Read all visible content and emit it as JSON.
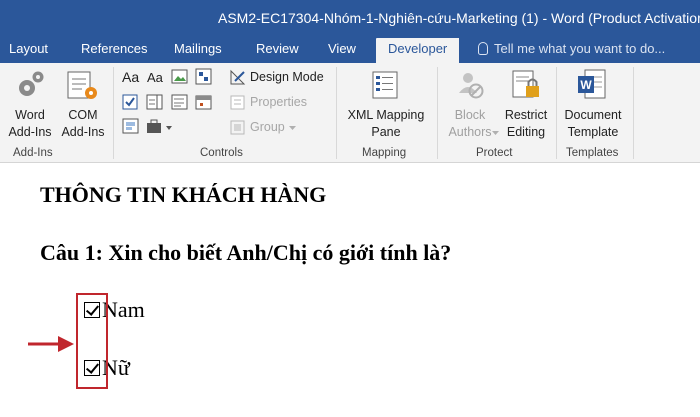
{
  "window": {
    "title": "ASM2-EC17304-Nhóm-1-Nghiên-cứu-Marketing (1) - Word (Product Activation Fa"
  },
  "tabs": {
    "layout": "Layout",
    "references": "References",
    "mailings": "Mailings",
    "review": "Review",
    "view": "View",
    "developer": "Developer",
    "tell_me": "Tell me what you want to do..."
  },
  "ribbon": {
    "addins": {
      "word_addins_line1": "Word",
      "word_addins_line2": "Add-Ins",
      "com_addins_line1": "COM",
      "com_addins_line2": "Add-Ins",
      "group": "Add-Ins"
    },
    "controls": {
      "design_mode": "Design Mode",
      "properties": "Properties",
      "group_btn": "Group",
      "group": "Controls",
      "aa_large": "Aa",
      "aa_small": "Aa"
    },
    "mapping": {
      "xml_line1": "XML Mapping",
      "xml_line2": "Pane",
      "group": "Mapping"
    },
    "protect": {
      "block_line1": "Block",
      "block_line2": "Authors",
      "restrict_line1": "Restrict",
      "restrict_line2": "Editing",
      "group": "Protect"
    },
    "templates": {
      "doc_line1": "Document",
      "doc_line2": "Template",
      "group": "Templates"
    }
  },
  "document": {
    "heading": "THÔNG TIN KHÁCH HÀNG",
    "question": "Câu 1: Xin cho biết Anh/Chị có giới tính là?",
    "options": [
      {
        "label": "Nam",
        "checked": true
      },
      {
        "label": "Nữ",
        "checked": true
      }
    ]
  },
  "colors": {
    "accent": "#2b579a",
    "highlight": "#c0262d"
  }
}
